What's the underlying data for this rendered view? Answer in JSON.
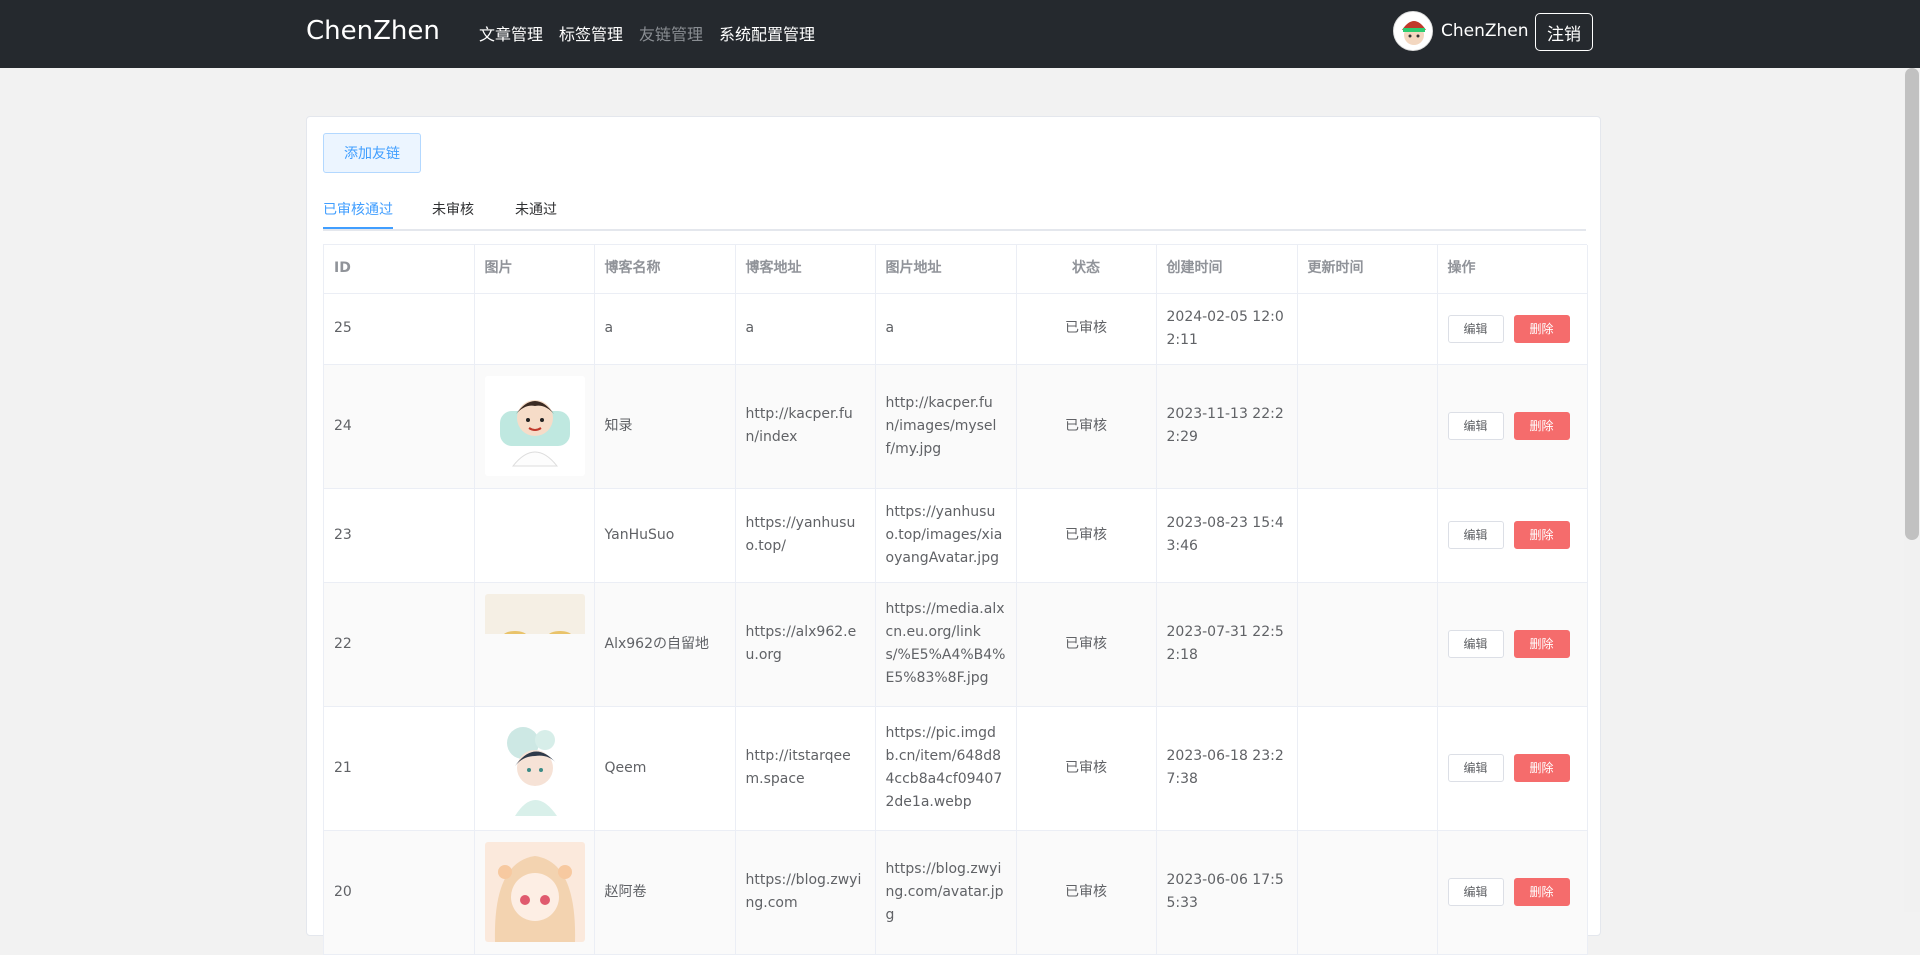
{
  "header": {
    "brand": "ChenZhen",
    "nav": [
      {
        "label": "文章管理",
        "active": false
      },
      {
        "label": "标签管理",
        "active": false
      },
      {
        "label": "友链管理",
        "active": true
      },
      {
        "label": "系统配置管理",
        "active": false
      }
    ],
    "username": "ChenZhen",
    "logout_label": "注销"
  },
  "toolbar": {
    "add_label": "添加友链"
  },
  "tabs": [
    "已审核通过",
    "未审核",
    "未通过"
  ],
  "table": {
    "columns": [
      "ID",
      "图片",
      "博客名称",
      "博客地址",
      "图片地址",
      "状态",
      "创建时间",
      "更新时间",
      "操作"
    ],
    "rows": [
      {
        "id": "25",
        "image": "none",
        "name": "a",
        "url": "a",
        "img_url": "a",
        "status": "已审核",
        "created": "2024-02-05 12:02:11",
        "updated": ""
      },
      {
        "id": "24",
        "image": "boy-avatar",
        "name": "知录",
        "url": "http://kacper.fun/index",
        "img_url": "http://kacper.fun/images/myself/my.jpg",
        "status": "已审核",
        "created": "2023-11-13 22:22:29",
        "updated": ""
      },
      {
        "id": "23",
        "image": "none",
        "name": "YanHuSuo",
        "url": "https://yanhusuo.top/",
        "img_url": "https://yanhusuo.top/images/xiaoyangAvatar.jpg",
        "status": "已审核",
        "created": "2023-08-23 15:43:46",
        "updated": ""
      },
      {
        "id": "22",
        "image": "partial-avatar",
        "name": "Alx962の自留地",
        "url": "https://alx962.eu.org",
        "img_url": "https://media.alxcn.eu.org/links/%E5%A4%B4%E5%83%8F.jpg",
        "status": "已审核",
        "created": "2023-07-31 22:52:18",
        "updated": ""
      },
      {
        "id": "21",
        "image": "anime-boy-avatar",
        "name": "Qeem",
        "url": "http://itstarqeem.space",
        "img_url": "https://pic.imgdb.cn/item/648d84ccb8a4cf094072de1a.webp",
        "status": "已审核",
        "created": "2023-06-18 23:27:38",
        "updated": ""
      },
      {
        "id": "20",
        "image": "anime-girl-avatar",
        "name": "赵阿卷",
        "url": "https://blog.zwying.com",
        "img_url": "https://blog.zwying.com/avatar.jpg",
        "status": "已审核",
        "created": "2023-06-06 17:55:33",
        "updated": ""
      }
    ],
    "edit_label": "编辑",
    "delete_label": "删除"
  },
  "colors": {
    "topbar": "#25292e",
    "primary": "#409eff",
    "danger": "#f56c6c"
  }
}
